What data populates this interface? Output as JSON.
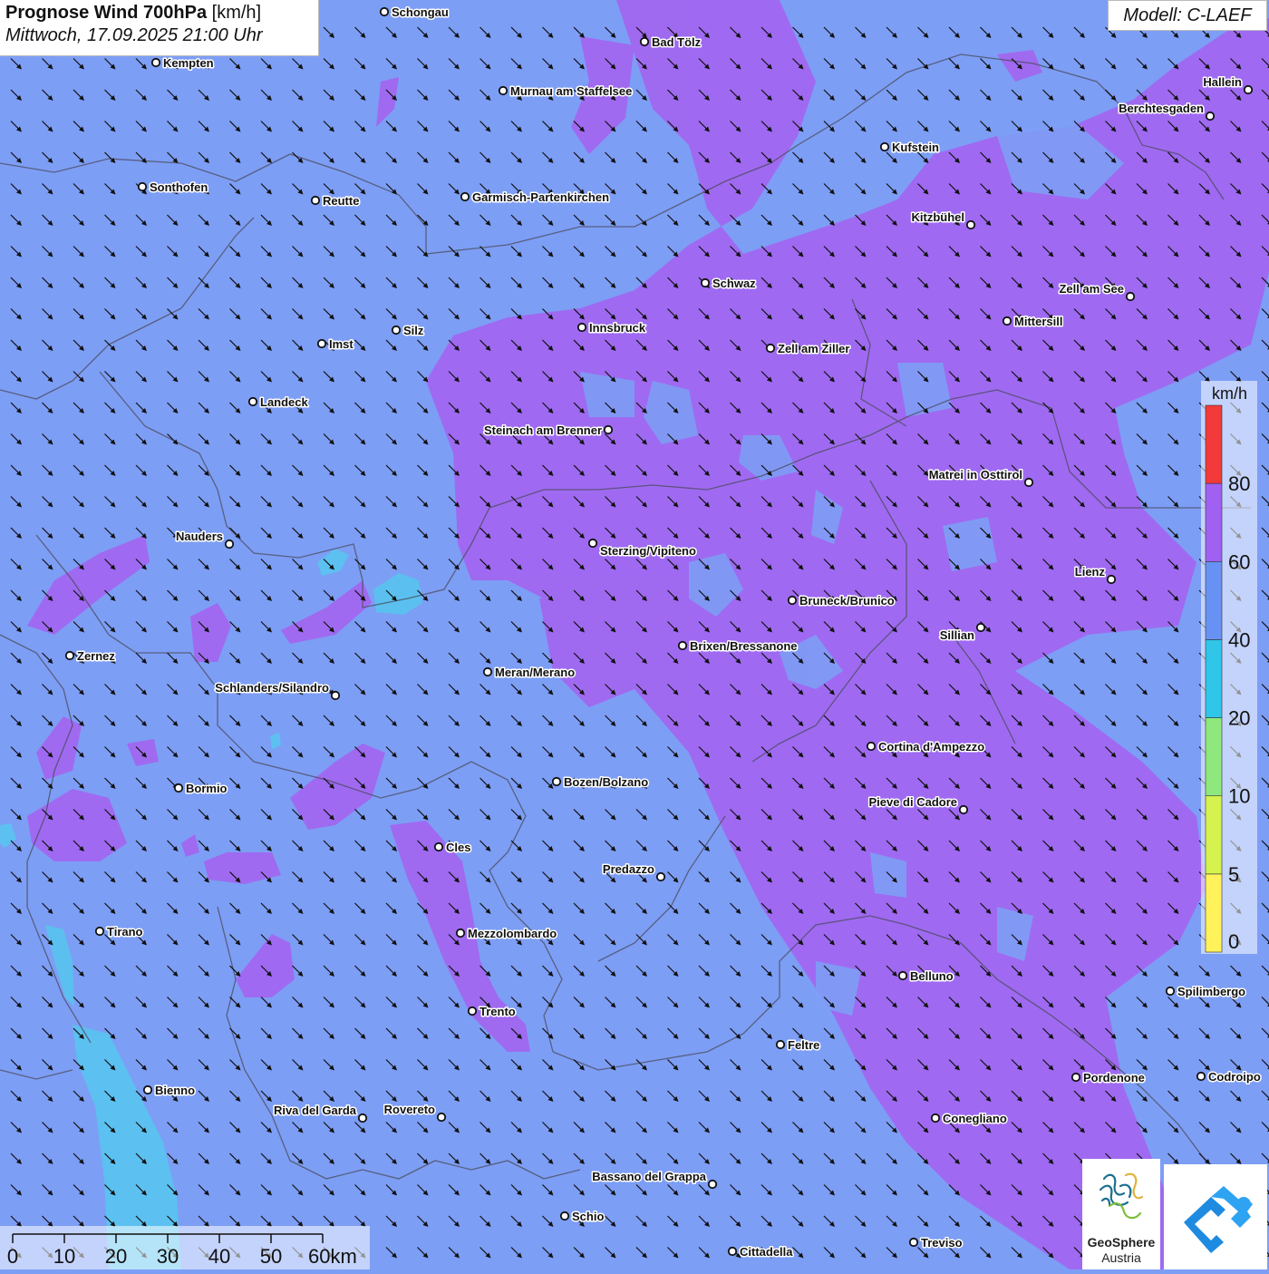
{
  "header": {
    "title_bold": "Prognose Wind 700hPa",
    "title_unit": " [km/h]",
    "datetime": "Mittwoch, 17.09.2025 21:00 Uhr",
    "model": "Modell: C-LAEF"
  },
  "legend": {
    "unit": "km/h",
    "classes": [
      {
        "label": "0",
        "color": "#fff25a"
      },
      {
        "label": "5",
        "color": "#d6f24f"
      },
      {
        "label": "10",
        "color": "#8ee87e"
      },
      {
        "label": "20",
        "color": "#2fc6ea"
      },
      {
        "label": "40",
        "color": "#6792f4"
      },
      {
        "label": "60",
        "color": "#a060f2"
      },
      {
        "label": "80",
        "color": "#f23a3a"
      }
    ]
  },
  "scale_bar": {
    "labels": [
      "0",
      "10",
      "20",
      "30",
      "40",
      "50",
      "60km"
    ]
  },
  "wind": {
    "direction": "from north-west toward south-east",
    "arrow_color": "#111111"
  },
  "cities": [
    "Schongau",
    "Bad Tölz",
    "Kempten",
    "Murnau am Staffelsee",
    "Hallein",
    "Berchtesgaden",
    "Kufstein",
    "Sonthofen",
    "Reutte",
    "Garmisch-Partenkirchen",
    "Kitzbühel",
    "Schwaz",
    "Zell am See",
    "Mittersill",
    "Innsbruck",
    "Silz",
    "Imst",
    "Zell am Ziller",
    "Landeck",
    "Steinach am Brenner",
    "Matrei in Osttirol",
    "Nauders",
    "Sterzing/Vipiteno",
    "Lienz",
    "Bruneck/Brunico",
    "Sillian",
    "Zernez",
    "Brixen/Bressanone",
    "Meran/Merano",
    "Schlanders/Silandro",
    "Cortina d'Ampezzo",
    "Bormio",
    "Bozen/Bolzano",
    "Pieve di Cadore",
    "Cles",
    "Predazzo",
    "Tirano",
    "Mezzolombardo",
    "Belluno",
    "Spilimbergo",
    "Trento",
    "Feltre",
    "Pordenone",
    "Codroipo",
    "Bienno",
    "Riva del Garda",
    "Rovereto",
    "Conegliano",
    "Bassano del Grappa",
    "Schio",
    "Treviso",
    "Cittadella"
  ],
  "logos": {
    "geosphere_name": "GeoSphere",
    "geosphere_sub": "Austria"
  }
}
